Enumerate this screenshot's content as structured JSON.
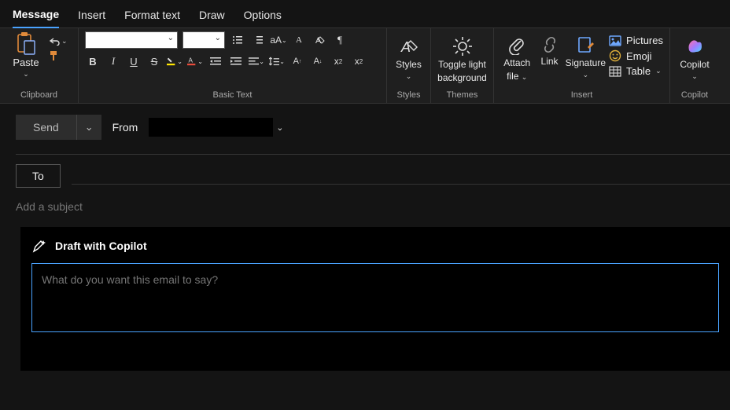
{
  "tabs": [
    "Message",
    "Insert",
    "Format text",
    "Draw",
    "Options"
  ],
  "active_tab_index": 0,
  "ribbon": {
    "clipboard": {
      "paste": "Paste",
      "label": "Clipboard"
    },
    "basictext": {
      "label": "Basic Text"
    },
    "styles": {
      "btn": "Styles",
      "label": "Styles"
    },
    "themes": {
      "btn_line1": "Toggle light",
      "btn_line2": "background",
      "label": "Themes"
    },
    "insert": {
      "attach_line1": "Attach",
      "attach_line2": "file",
      "link": "Link",
      "signature": "Signature",
      "pictures": "Pictures",
      "emoji": "Emoji",
      "table": "Table",
      "label": "Insert"
    },
    "copilot": {
      "btn": "Copilot",
      "label": "Copilot"
    }
  },
  "compose": {
    "send": "Send",
    "from_label": "From",
    "from_value": "",
    "to": "To",
    "subject_placeholder": "Add a subject"
  },
  "copilot_panel": {
    "title": "Draft with Copilot",
    "placeholder": "What do you want this email to say?"
  },
  "colors": {
    "accent": "#4aa3ff"
  }
}
